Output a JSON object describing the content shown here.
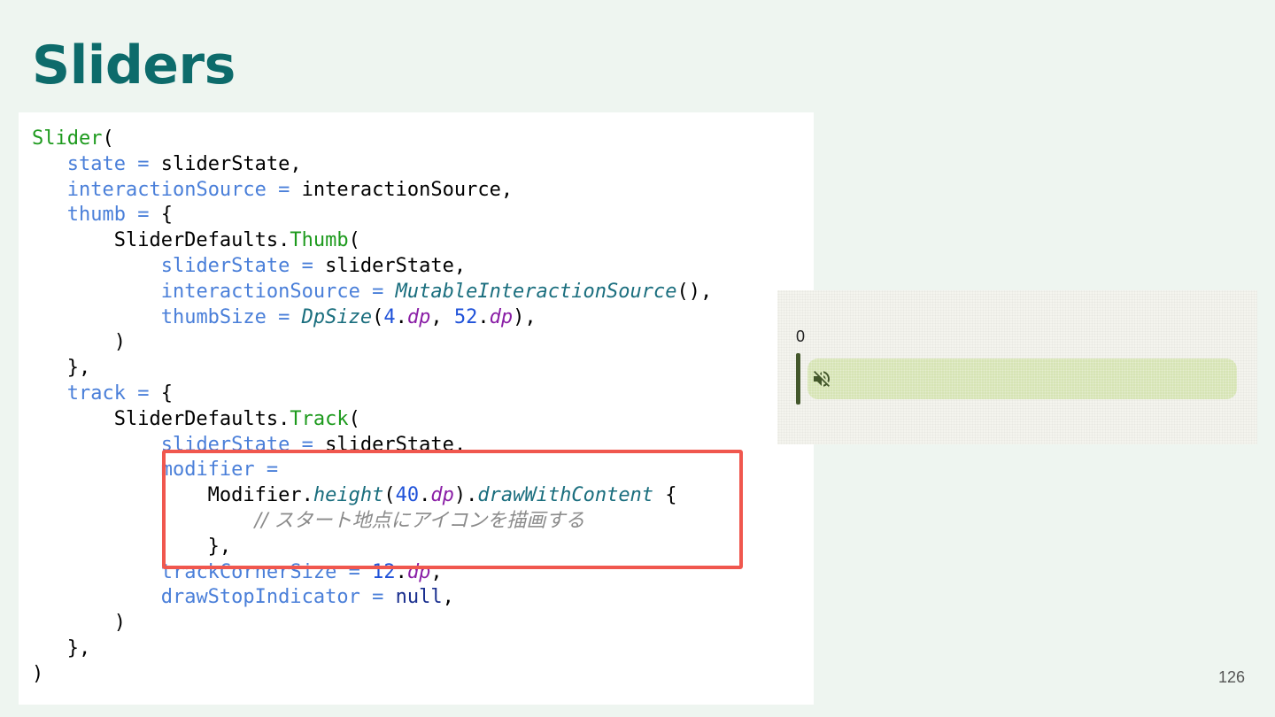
{
  "slide": {
    "title": "Sliders",
    "page_number": "126"
  },
  "code": {
    "lines": [
      [
        {
          "t": "Slider",
          "c": "g"
        },
        {
          "t": "("
        }
      ],
      [
        {
          "t": "   "
        },
        {
          "t": "state = ",
          "c": "p"
        },
        {
          "t": "sliderState,"
        }
      ],
      [
        {
          "t": "   "
        },
        {
          "t": "interactionSource = ",
          "c": "p"
        },
        {
          "t": "interactionSource,"
        }
      ],
      [
        {
          "t": "   "
        },
        {
          "t": "thumb = ",
          "c": "p"
        },
        {
          "t": "{"
        }
      ],
      [
        {
          "t": "       SliderDefaults."
        },
        {
          "t": "Thumb",
          "c": "g"
        },
        {
          "t": "("
        }
      ],
      [
        {
          "t": "           "
        },
        {
          "t": "sliderState = ",
          "c": "p"
        },
        {
          "t": "sliderState,"
        }
      ],
      [
        {
          "t": "           "
        },
        {
          "t": "interactionSource = ",
          "c": "p"
        },
        {
          "t": "MutableInteractionSource",
          "c": "it"
        },
        {
          "t": "(),"
        }
      ],
      [
        {
          "t": "           "
        },
        {
          "t": "thumbSize = ",
          "c": "p"
        },
        {
          "t": "DpSize",
          "c": "it"
        },
        {
          "t": "("
        },
        {
          "t": "4",
          "c": "num"
        },
        {
          "t": "."
        },
        {
          "t": "dp",
          "c": "u"
        },
        {
          "t": ", "
        },
        {
          "t": "52",
          "c": "num"
        },
        {
          "t": "."
        },
        {
          "t": "dp",
          "c": "u"
        },
        {
          "t": "),"
        }
      ],
      [
        {
          "t": "       )"
        }
      ],
      [
        {
          "t": "   },"
        }
      ],
      [
        {
          "t": "   "
        },
        {
          "t": "track = ",
          "c": "p"
        },
        {
          "t": "{"
        }
      ],
      [
        {
          "t": "       SliderDefaults."
        },
        {
          "t": "Track",
          "c": "g"
        },
        {
          "t": "("
        }
      ],
      [
        {
          "t": "           "
        },
        {
          "t": "sliderState = ",
          "c": "p"
        },
        {
          "t": "sliderState,"
        }
      ],
      [
        {
          "t": "           "
        },
        {
          "t": "modifier =",
          "c": "p"
        }
      ],
      [
        {
          "t": "               Modifier."
        },
        {
          "t": "height",
          "c": "it"
        },
        {
          "t": "("
        },
        {
          "t": "40",
          "c": "num"
        },
        {
          "t": "."
        },
        {
          "t": "dp",
          "c": "u"
        },
        {
          "t": ")."
        },
        {
          "t": "drawWithContent",
          "c": "it"
        },
        {
          "t": " {"
        }
      ],
      [
        {
          "t": "                   "
        },
        {
          "t": "// スタート地点にアイコンを描画する",
          "c": "cm"
        }
      ],
      [
        {
          "t": "               },"
        }
      ],
      [
        {
          "t": "           "
        },
        {
          "t": "trackCornerSize = ",
          "c": "p"
        },
        {
          "t": "12",
          "c": "num"
        },
        {
          "t": "."
        },
        {
          "t": "dp",
          "c": "u"
        },
        {
          "t": ","
        }
      ],
      [
        {
          "t": "           "
        },
        {
          "t": "drawStopIndicator = ",
          "c": "p"
        },
        {
          "t": "null",
          "c": "kw"
        },
        {
          "t": ","
        }
      ],
      [
        {
          "t": "       )"
        }
      ],
      [
        {
          "t": "   },"
        }
      ],
      [
        {
          "t": ")"
        }
      ]
    ]
  },
  "preview": {
    "slider_value_label": "0",
    "slider_value": 0,
    "track_icon": "volume-off-icon",
    "colors": {
      "track": "#d6e4b4",
      "thumb": "#43572b",
      "highlight": "#f0574e",
      "title": "#0d6b6b"
    }
  }
}
